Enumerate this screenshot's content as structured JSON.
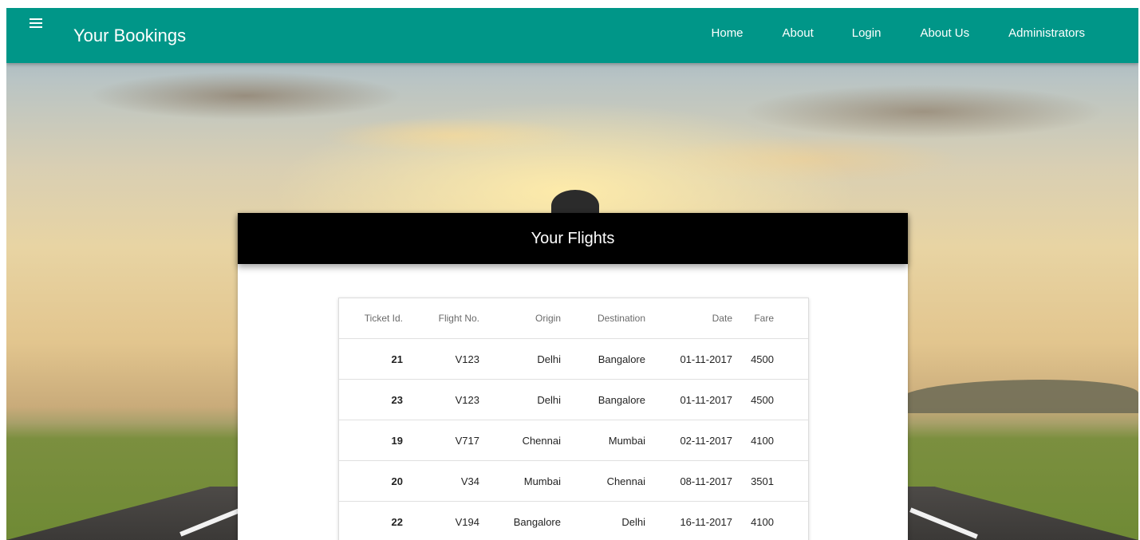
{
  "navbar": {
    "title": "Your Bookings",
    "menu_icon": "hamburger-menu-icon",
    "links": [
      "Home",
      "About",
      "Login",
      "About Us",
      "Administrators"
    ],
    "background_color": "#009688"
  },
  "card": {
    "title": "Your Flights"
  },
  "table": {
    "columns": [
      "Ticket Id.",
      "Flight No.",
      "Origin",
      "Destination",
      "Date",
      "Fare"
    ],
    "rows": [
      [
        "21",
        "V123",
        "Delhi",
        "Bangalore",
        "01-11-2017",
        "4500"
      ],
      [
        "23",
        "V123",
        "Delhi",
        "Bangalore",
        "01-11-2017",
        "4500"
      ],
      [
        "19",
        "V717",
        "Chennai",
        "Mumbai",
        "02-11-2017",
        "4100"
      ],
      [
        "20",
        "V34",
        "Mumbai",
        "Chennai",
        "08-11-2017",
        "3501"
      ],
      [
        "22",
        "V194",
        "Bangalore",
        "Delhi",
        "16-11-2017",
        "4100"
      ]
    ]
  }
}
